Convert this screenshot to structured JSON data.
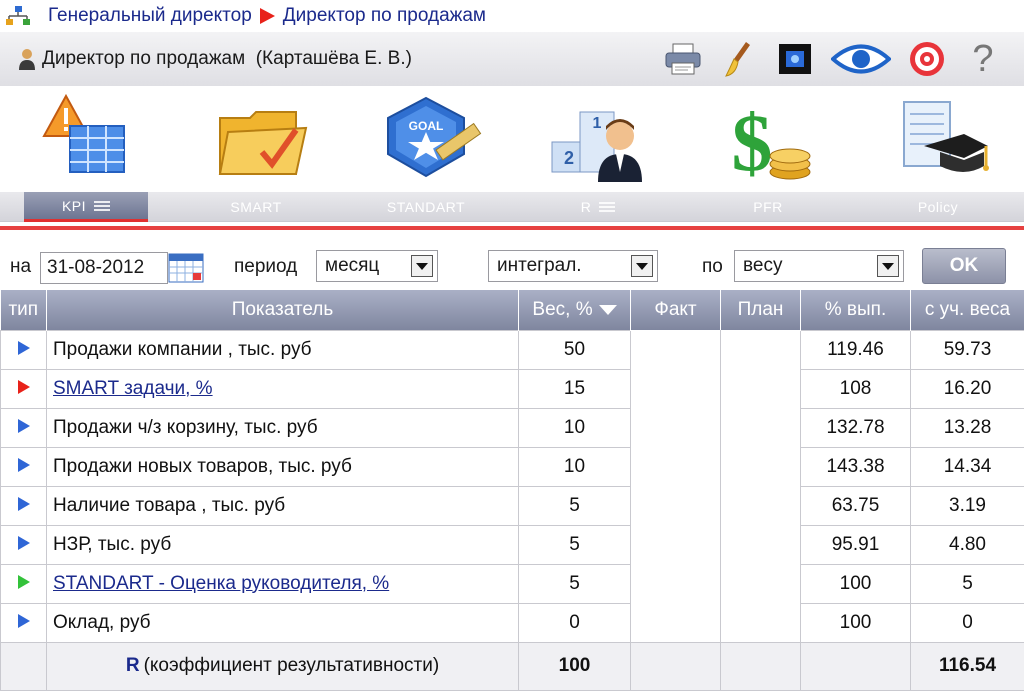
{
  "breadcrumb": {
    "root": "Генеральный директор",
    "current": "Директор по продажам"
  },
  "header": {
    "user": "Директор по продажам  (Карташёва Е. В.)"
  },
  "tools": [
    "printer-icon",
    "brush-icon",
    "screen-icon",
    "eye-icon",
    "target-icon",
    "help-icon"
  ],
  "modules": [
    {
      "label": "KPI",
      "active": true
    },
    {
      "label": "SMART"
    },
    {
      "label": "STANDART"
    },
    {
      "label": "R"
    },
    {
      "label": "PFR"
    },
    {
      "label": "Policy"
    }
  ],
  "goal_badge": "GOAL",
  "filter": {
    "date_label": "на",
    "date_value": "31-08-2012",
    "period_label": "период",
    "period_value": "месяц",
    "mode_value": "интеграл.",
    "by_label": "по",
    "by_value": "весу",
    "ok_label": "OK"
  },
  "table": {
    "headers": [
      "тип",
      "Показатель",
      "Вес, %",
      "Факт",
      "План",
      "% вып.",
      "с уч. веса"
    ],
    "rows": [
      {
        "type": "blue",
        "name": "Продажи компании , тыс. руб",
        "link": false,
        "weight": "50",
        "pct": "119.46",
        "weighted": "59.73"
      },
      {
        "type": "red",
        "name": "SMART задачи, %",
        "link": true,
        "weight": "15",
        "pct": "108",
        "weighted": "16.20"
      },
      {
        "type": "blue",
        "name": "Продажи ч/з корзину, тыс. руб",
        "link": false,
        "weight": "10",
        "pct": "132.78",
        "weighted": "13.28"
      },
      {
        "type": "blue",
        "name": "Продажи новых товаров, тыс. руб",
        "link": false,
        "weight": "10",
        "pct": "143.38",
        "weighted": "14.34"
      },
      {
        "type": "blue",
        "name": "Наличие товара , тыс. руб",
        "link": false,
        "weight": "5",
        "pct": "63.75",
        "weighted": "3.19"
      },
      {
        "type": "blue",
        "name": "НЗР, тыс. руб",
        "link": false,
        "weight": "5",
        "pct": "95.91",
        "weighted": "4.80"
      },
      {
        "type": "green",
        "name": "STANDART - Оценка руководителя, %",
        "link": true,
        "weight": "5",
        "pct": "100",
        "weighted": "5"
      },
      {
        "type": "blue",
        "name": "Оклад, руб",
        "link": false,
        "weight": "0",
        "pct": "100",
        "weighted": "0"
      }
    ],
    "total": {
      "label_letter": "R",
      "label_text": "(коэффициент результативности)",
      "weight": "100",
      "weighted": "116.54"
    }
  },
  "colors": {
    "blue": "#2f66d6",
    "red": "#e8221a",
    "green": "#33c23a",
    "accent": "#1b2a8c"
  }
}
